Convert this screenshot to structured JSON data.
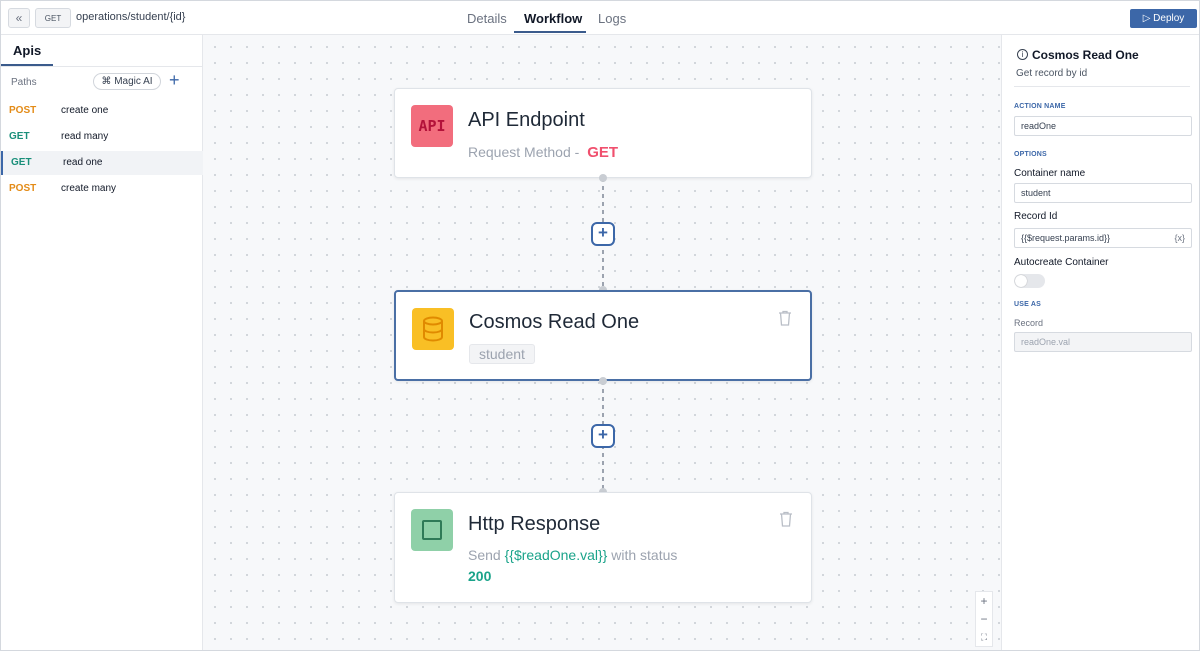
{
  "topbar": {
    "collapse_icon": "«",
    "method": "GET",
    "path": "operations/student/{id}",
    "tabs": [
      {
        "label": "Details"
      },
      {
        "label": "Workflow"
      },
      {
        "label": "Logs"
      }
    ],
    "active_tab": "Workflow",
    "deploy_label": "▷ Deploy"
  },
  "sidebar": {
    "tab_label": "Apis",
    "paths_label": "Paths",
    "magic_label": "⌘ Magic AI",
    "add_icon": "+",
    "routes": [
      {
        "method": "POST",
        "name": "create one",
        "color": "#e38b17"
      },
      {
        "method": "GET",
        "name": "read many",
        "color": "#1a8f7a"
      },
      {
        "method": "GET",
        "name": "read one",
        "color": "#1a8f7a"
      },
      {
        "method": "POST",
        "name": "create many",
        "color": "#e38b17"
      }
    ]
  },
  "canvas": {
    "nodes": [
      {
        "title": "API Endpoint",
        "icon_text": "API",
        "subtitle_prefix": "Request Method -",
        "method_value": "GET"
      },
      {
        "title": "Cosmos Read One",
        "tag": "student"
      },
      {
        "title": "Http Response",
        "send_prefix": "Send",
        "send_var": "{{$readOne.val}}",
        "send_suffix": "with status",
        "status": "200"
      }
    ],
    "add_icon": "+",
    "zoom": {
      "in": "+",
      "out": "−",
      "fit": "⛶"
    }
  },
  "panel": {
    "info_icon": "i",
    "title": "Cosmos Read One",
    "subtitle": "Get record by id",
    "action_name_label": "ACTION NAME",
    "action_name_value": "readOne",
    "options_label": "OPTIONS",
    "container_label": "Container name",
    "container_value": "student",
    "record_id_label": "Record Id",
    "record_id_value": "{{$request.params.id}}",
    "var_chip": "{x}",
    "autocreate_label": "Autocreate Container",
    "autocreate_on": false,
    "use_as_label": "USE AS",
    "record_label": "Record",
    "record_value": "readOne.val"
  },
  "colors": {
    "accent": "#3c67a8",
    "api_icon_bg": "#f26d7d",
    "cosmos_icon_bg": "#f9bf25",
    "response_icon_bg": "#8fd0a8",
    "get_red": "#f0506e",
    "teal": "#1aa38a"
  }
}
